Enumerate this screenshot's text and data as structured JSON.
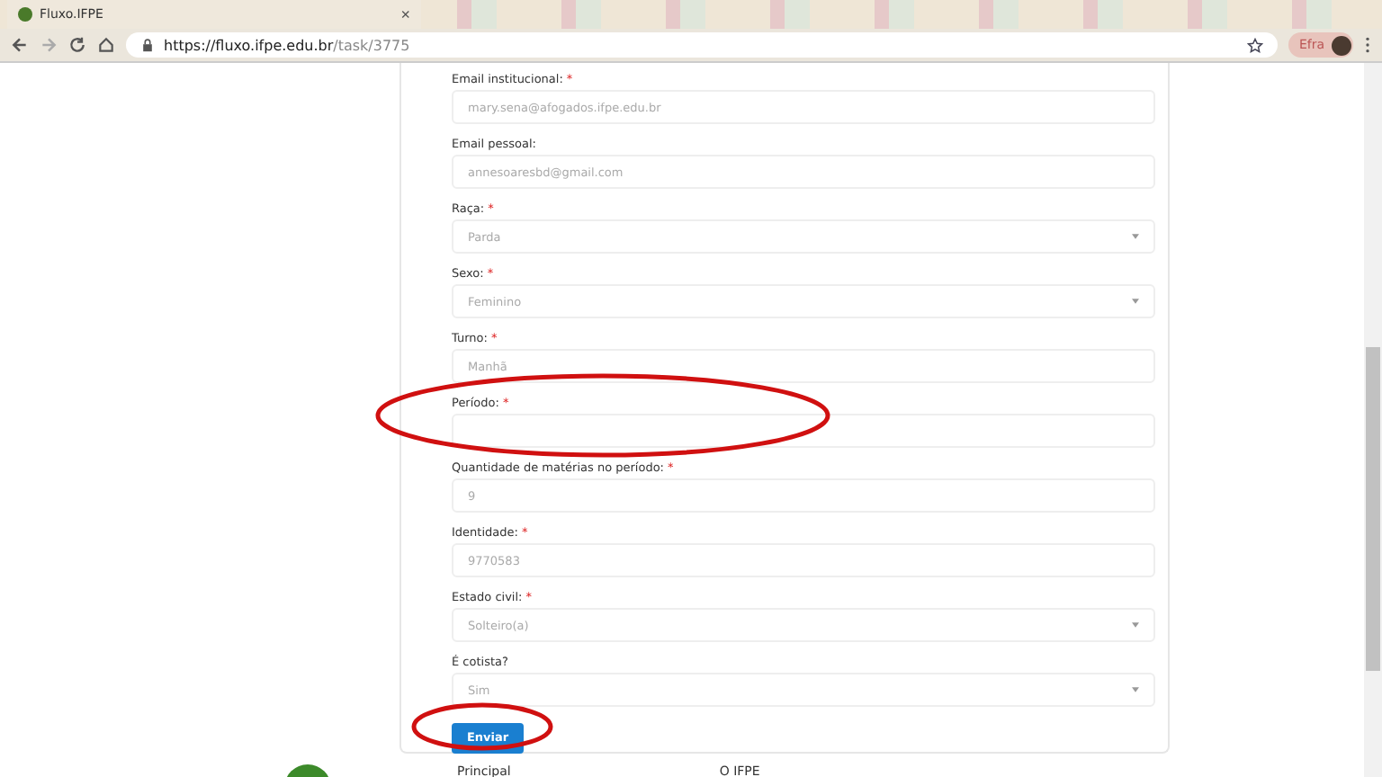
{
  "browser": {
    "tab": {
      "title": "Fluxo.IFPE",
      "close": "×"
    },
    "address": {
      "host": "https://fluxo.ifpe.edu.br",
      "path": "/task/3775"
    },
    "profile": "Efra"
  },
  "form": {
    "fields": [
      {
        "label": "Email institucional:",
        "required_mark": "*",
        "kind": "input",
        "value": "mary.sena@afogados.ifpe.edu.br"
      },
      {
        "label": "Email pessoal:",
        "kind": "input",
        "value": "annesoaresbd@gmail.com"
      },
      {
        "label": "Raça:",
        "required_mark": "*",
        "kind": "select",
        "value": "Parda"
      },
      {
        "label": "Sexo:",
        "required_mark": "*",
        "kind": "select",
        "value": "Feminino"
      },
      {
        "label": "Turno:",
        "required_mark": "*",
        "kind": "input",
        "value": "Manhã"
      },
      {
        "label": "Período:",
        "required_mark": "*",
        "kind": "input"
      },
      {
        "label": "Quantidade de matérias no período:",
        "required_mark": "*",
        "kind": "input",
        "value": "9"
      },
      {
        "label": "Identidade:",
        "required_mark": "*",
        "kind": "input",
        "value": "9770583"
      },
      {
        "label": "Estado civil:",
        "required_mark": "*",
        "kind": "select",
        "value": "Solteiro(a)"
      },
      {
        "label": "É cotista?",
        "kind": "select",
        "value": "Sim"
      }
    ],
    "submit": "Enviar"
  },
  "footer": {
    "links": [
      "Principal",
      "O IFPE"
    ]
  }
}
